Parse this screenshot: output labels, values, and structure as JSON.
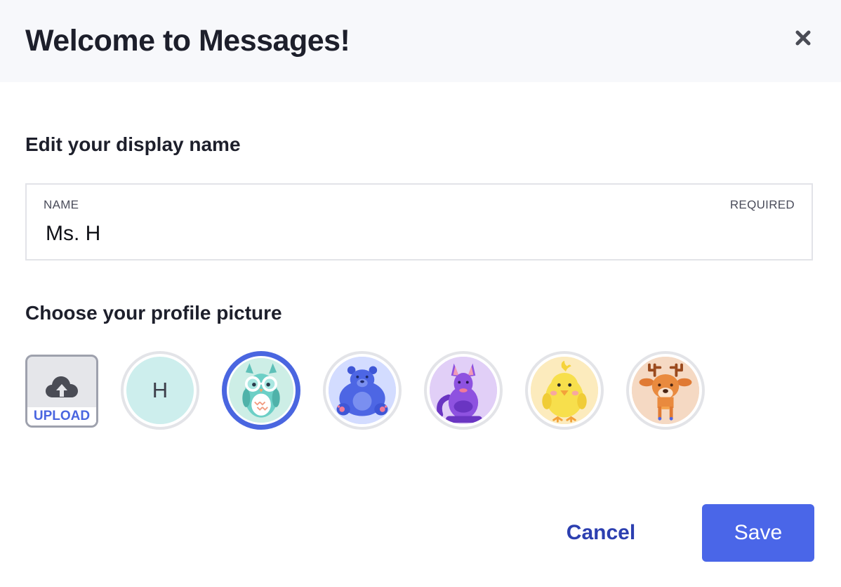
{
  "dialog": {
    "title": "Welcome to Messages!",
    "close_icon": "close-icon"
  },
  "display_name_section": {
    "heading": "Edit your display name",
    "field_label": "NAME",
    "required_label": "REQUIRED",
    "value": "Ms. H"
  },
  "profile_picture_section": {
    "heading": "Choose your profile picture",
    "upload_label": "UPLOAD",
    "upload_icon": "cloud-upload-icon",
    "initial_avatar_letter": "H",
    "avatars": [
      {
        "name": "initial-h",
        "icon": "letter-avatar",
        "selected": false
      },
      {
        "name": "owl",
        "icon": "owl-icon",
        "selected": true
      },
      {
        "name": "bear",
        "icon": "bear-icon",
        "selected": false
      },
      {
        "name": "kangaroo",
        "icon": "kangaroo-icon",
        "selected": false
      },
      {
        "name": "chick",
        "icon": "chick-icon",
        "selected": false
      },
      {
        "name": "deer",
        "icon": "deer-icon",
        "selected": false
      }
    ]
  },
  "actions": {
    "cancel_label": "Cancel",
    "save_label": "Save"
  },
  "colors": {
    "accent": "#4a66e8",
    "cancel_text": "#2c3fb0",
    "header_bg": "#f7f8fb"
  }
}
